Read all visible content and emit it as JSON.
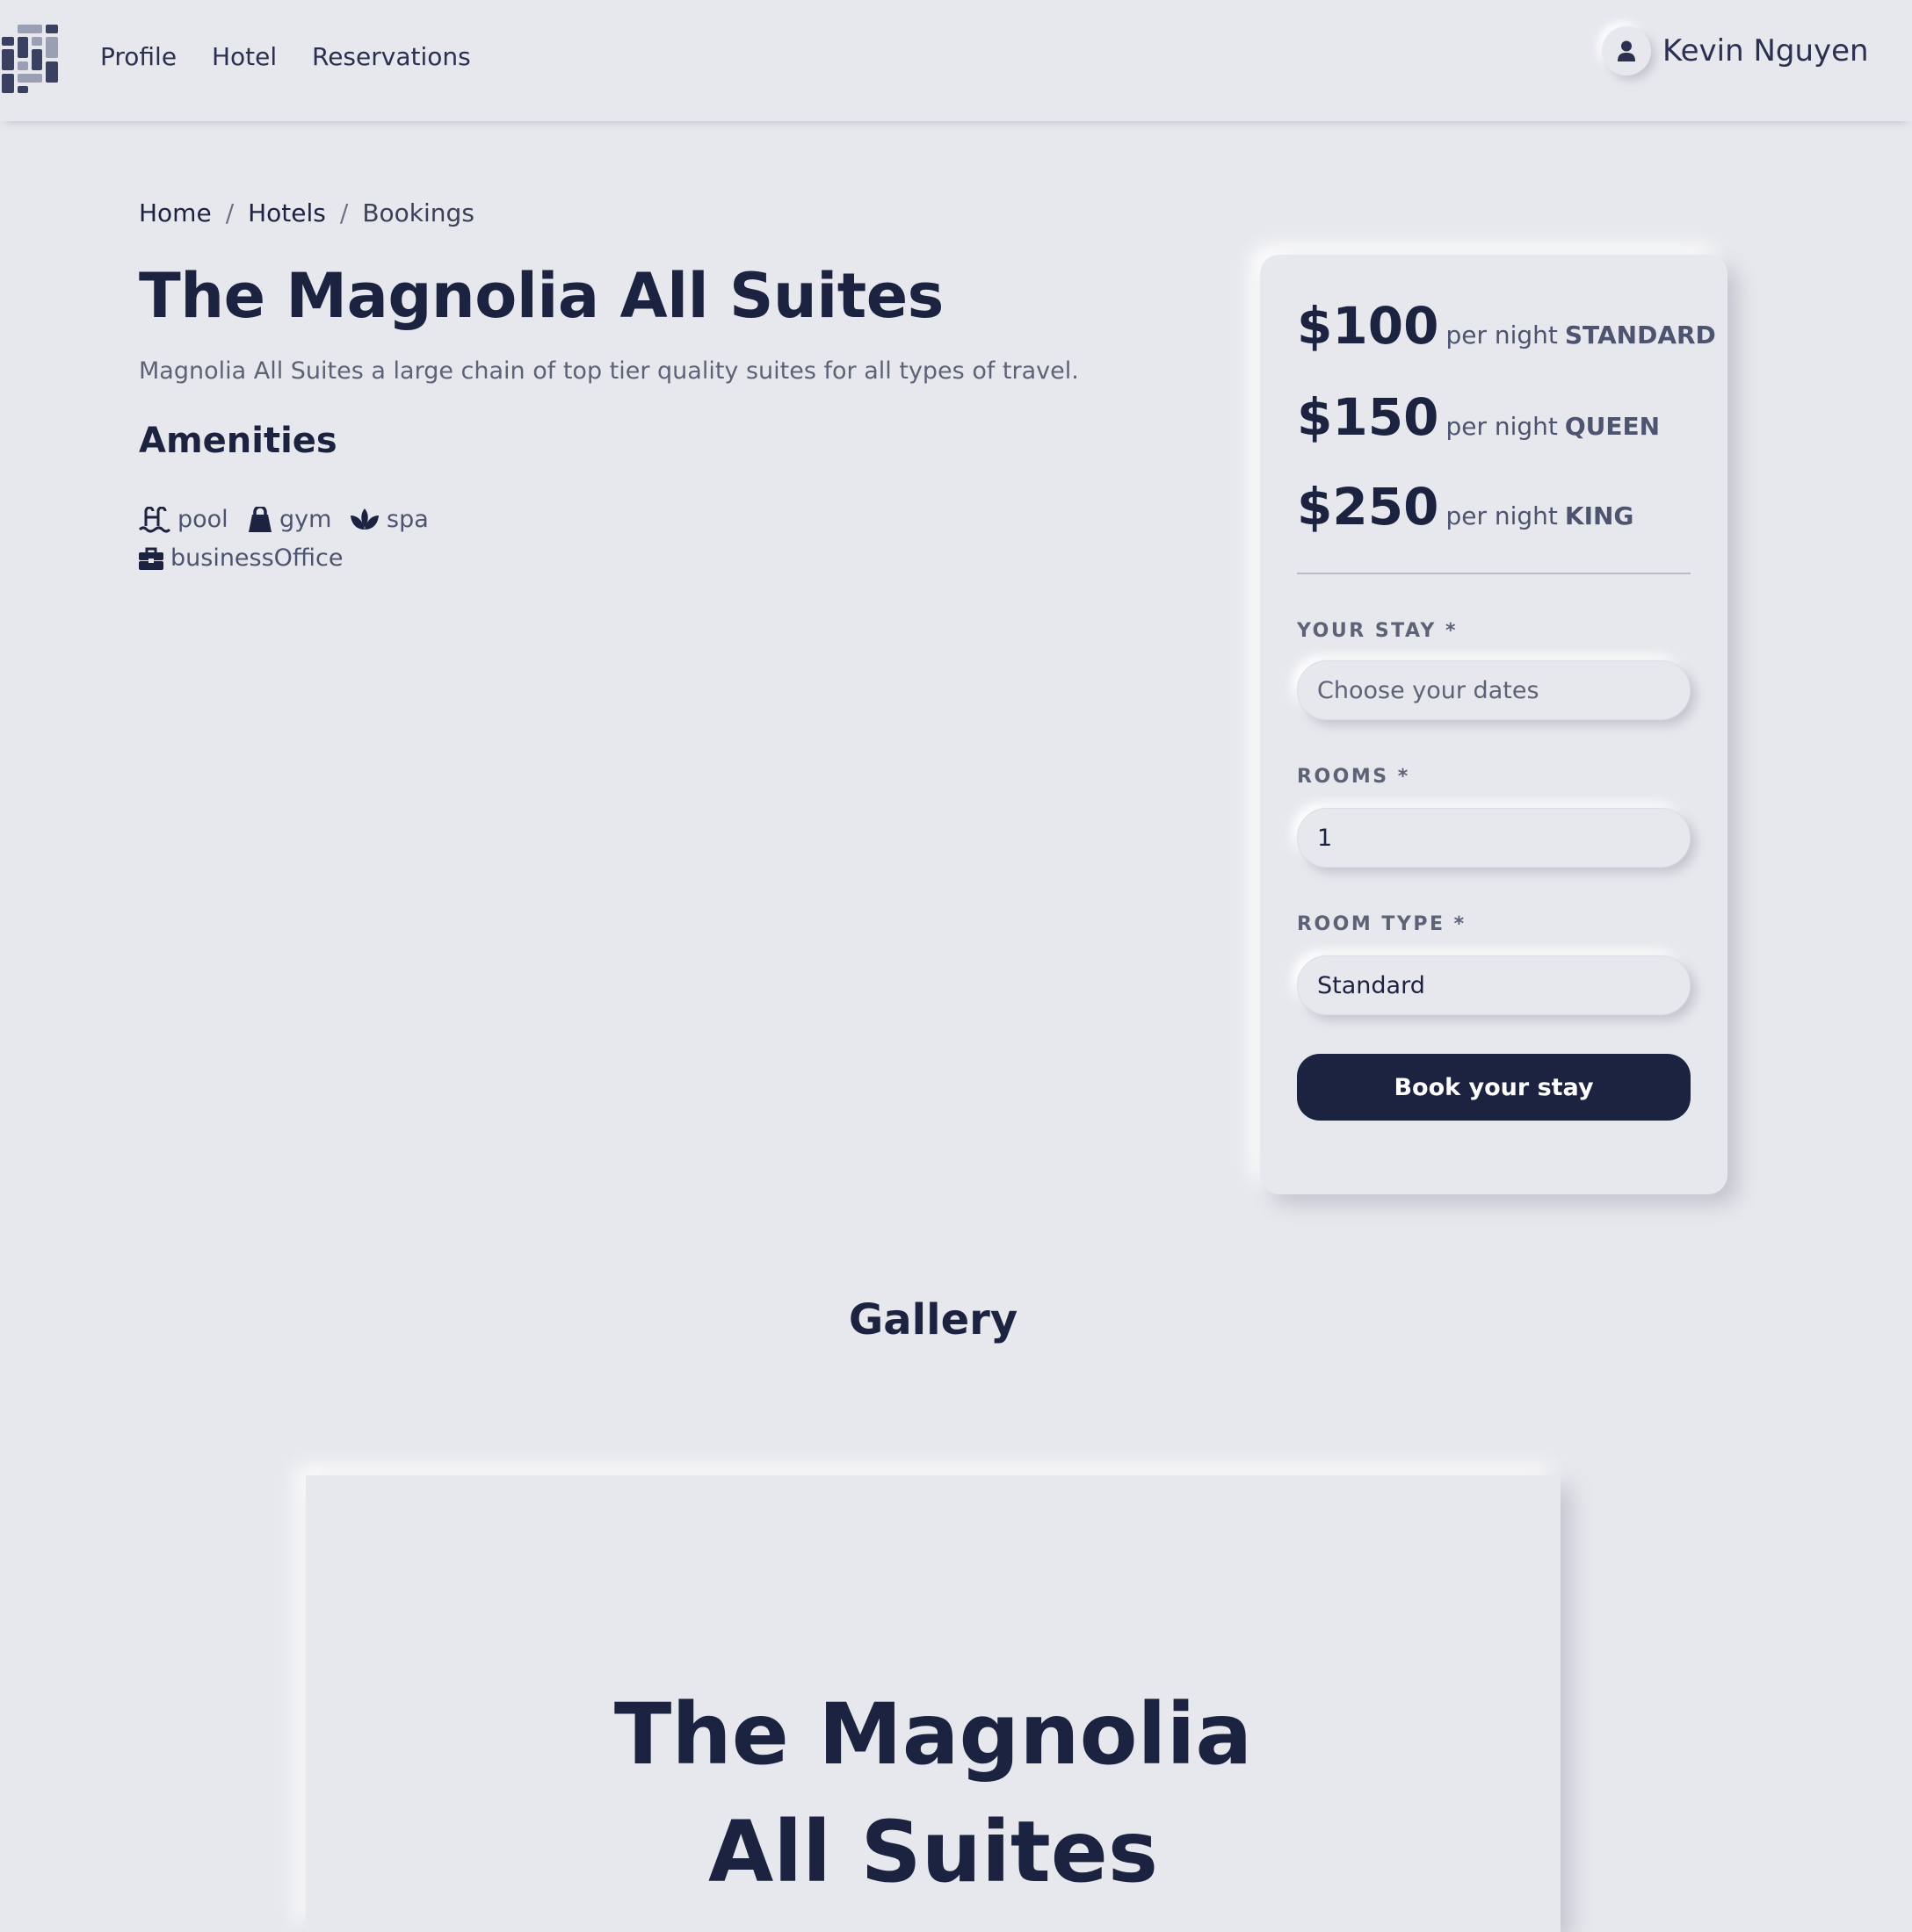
{
  "nav": {
    "logo_icon": "app-logo-icon",
    "links": [
      "Profile",
      "Hotel",
      "Reservations"
    ],
    "user_icon": "user-icon",
    "user_name": "Kevin Nguyen"
  },
  "breadcrumb": [
    "Home",
    "Hotels",
    "Bookings"
  ],
  "breadcrumb_separator": "/",
  "hotel": {
    "name": "The Magnolia All Suites",
    "description": "Magnolia All Suites a large chain of top tier quality suites for all types of travel."
  },
  "amenities": {
    "heading": "Amenities",
    "items": [
      {
        "label": "pool",
        "icon": "pool-icon"
      },
      {
        "label": "gym",
        "icon": "kettlebell-icon"
      },
      {
        "label": "spa",
        "icon": "spa-lotus-icon"
      },
      {
        "label": "businessOffice",
        "icon": "briefcase-icon"
      }
    ]
  },
  "booking": {
    "prices": [
      {
        "amount": "$100",
        "unit": "per night",
        "room": "STANDARD"
      },
      {
        "amount": "$150",
        "unit": "per night",
        "room": "QUEEN"
      },
      {
        "amount": "$250",
        "unit": "per night",
        "room": "KING"
      }
    ],
    "stay_label": "YOUR STAY *",
    "stay_placeholder": "Choose your dates",
    "rooms_label": "ROOMS *",
    "rooms_value": "1",
    "room_type_label": "ROOM TYPE *",
    "room_type_value": "Standard",
    "submit_label": "Book your stay"
  },
  "gallery": {
    "heading": "Gallery",
    "slide_title": "The Magnolia All Suites"
  },
  "colors": {
    "background": "#e7e8ed",
    "primary": "#1c2340",
    "muted_text": "#5d6377"
  }
}
